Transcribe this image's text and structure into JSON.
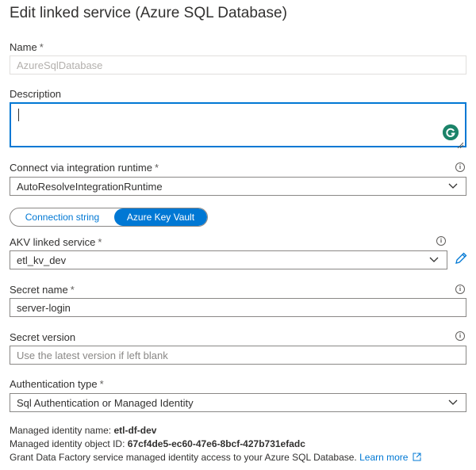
{
  "header": {
    "title": "Edit linked service (Azure SQL Database)"
  },
  "name": {
    "label": "Name",
    "required": "*",
    "placeholder": "AzureSqlDatabase"
  },
  "description": {
    "label": "Description",
    "value": ""
  },
  "runtime": {
    "label": "Connect via integration runtime",
    "required": "*",
    "value": "AutoResolveIntegrationRuntime"
  },
  "connection_toggle": {
    "options": [
      "Connection string",
      "Azure Key Vault"
    ],
    "selected": "Azure Key Vault"
  },
  "akv": {
    "label": "AKV linked service",
    "required": "*",
    "value": "etl_kv_dev"
  },
  "secret_name": {
    "label": "Secret name",
    "required": "*",
    "value": "server-login"
  },
  "secret_version": {
    "label": "Secret version",
    "placeholder": "Use the latest version if left blank"
  },
  "auth": {
    "label": "Authentication type",
    "required": "*",
    "value": "Sql Authentication or Managed Identity"
  },
  "managed_identity": {
    "name_label": "Managed identity name:",
    "name_value": "etl-df-dev",
    "object_id_label": "Managed identity object ID:",
    "object_id_value": "67cf4de5-ec60-47e6-8bcf-427b731efadc",
    "grant_text": "Grant Data Factory service managed identity access to your Azure SQL Database.",
    "learn_more": "Learn more"
  },
  "colors": {
    "accent": "#0078d4",
    "border": "#8a8886",
    "text": "#323130"
  }
}
